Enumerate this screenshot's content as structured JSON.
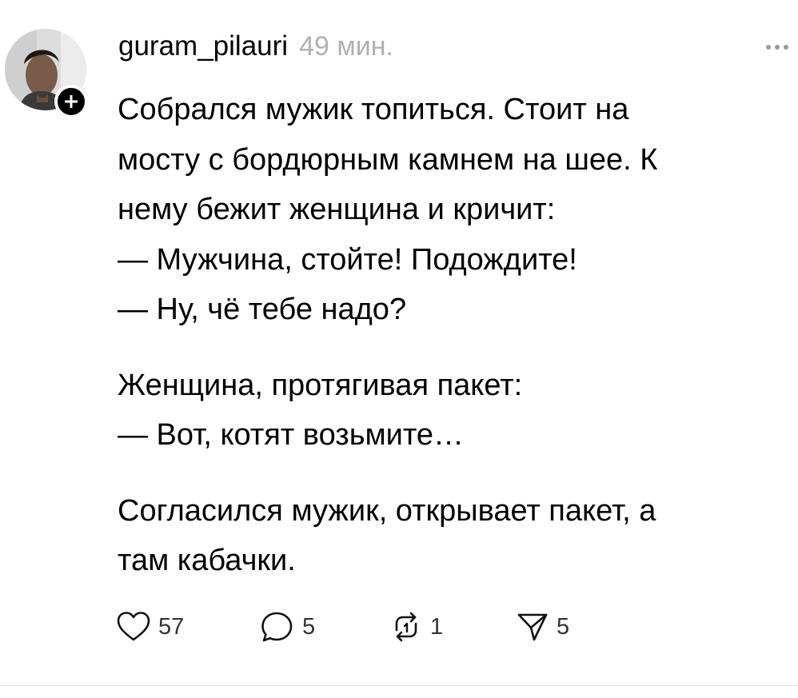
{
  "post": {
    "username": "guram_pilauri",
    "time": "49 мин.",
    "lines": [
      "Собрался мужик топиться. Стоит на",
      "мосту с бордюрным камнем на шее. К",
      "нему бежит женщина и кричит:",
      "— Мужчина, стойте! Подождите!",
      "— Ну, чё тебе надо?",
      "Женщина, протягивая пакет:",
      "— Вот, котят возьмите…",
      "Согласился мужик, открывает пакет, а",
      "там кабачки."
    ],
    "actions": {
      "likes": "57",
      "replies": "5",
      "reposts": "1",
      "shares": "5"
    }
  },
  "icons": {
    "avatar": "avatar-photo",
    "follow": "plus-icon",
    "more": "more-dots-icon",
    "like": "heart-icon",
    "reply": "comment-icon",
    "repost": "repost-icon",
    "share": "send-icon"
  },
  "colors": {
    "text": "#000000",
    "time": "#b0b0b0",
    "more_dots": "#9a9a9a",
    "counts": "#333333",
    "divider": "#e2e2e2"
  }
}
